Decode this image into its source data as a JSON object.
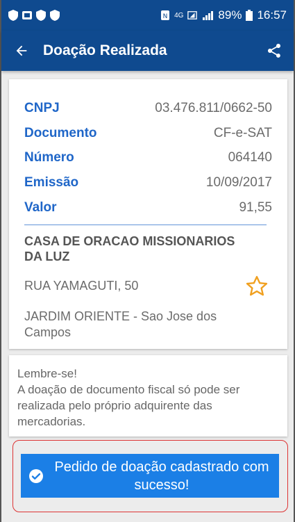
{
  "status_bar": {
    "network": "4G",
    "battery": "89%",
    "time": "16:57"
  },
  "app_bar": {
    "title": "Doação Realizada",
    "back_icon": "arrow-left-icon",
    "share_icon": "share-icon"
  },
  "details": {
    "rows": [
      {
        "label": "CNPJ",
        "value": "03.476.811/0662-50"
      },
      {
        "label": "Documento",
        "value": "CF-e-SAT"
      },
      {
        "label": "Número",
        "value": "064140"
      },
      {
        "label": "Emissão",
        "value": "10/09/2017"
      },
      {
        "label": "Valor",
        "value": "91,55"
      }
    ],
    "org_name": "CASA DE ORACAO MISSIONARIOS DA LUZ",
    "address": "RUA YAMAGUTI, 50",
    "city": "JARDIM ORIENTE - Sao Jose dos Campos",
    "favorite_icon": "star-outline-icon"
  },
  "note": {
    "title": "Lembre-se!",
    "text": "A doação de documento fiscal só pode ser realizada pelo próprio adquirente das mercadorias."
  },
  "toast": {
    "icon": "check-circle-icon",
    "message": "Pedido de doação cadastrado com sucesso!"
  },
  "colors": {
    "app_bar": "#0f4a8f",
    "label_blue": "#1f66c8",
    "toast_bg": "#1b7fe6",
    "star": "#f0a020"
  }
}
